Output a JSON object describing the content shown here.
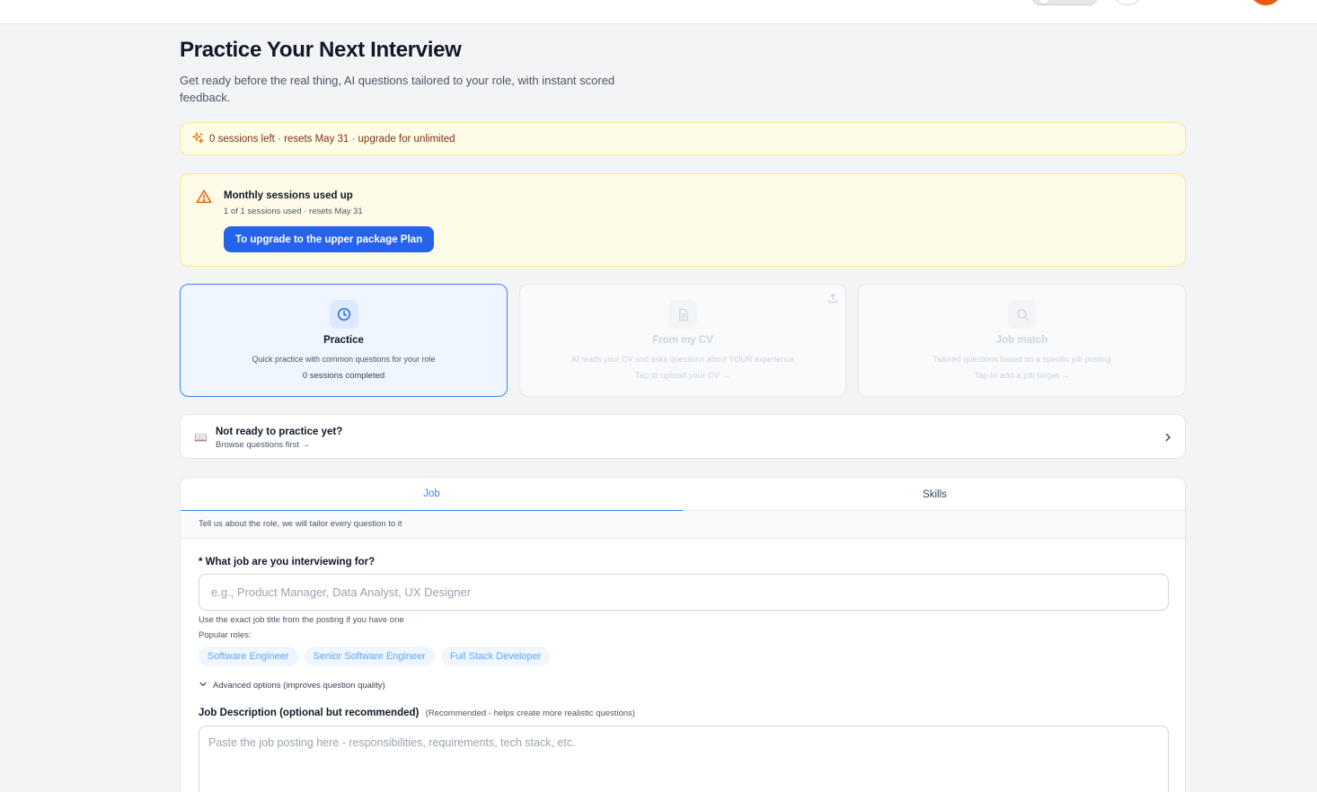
{
  "page": {
    "title": "Practice Your Next Interview",
    "subtitle": "Get ready before the real thing, AI questions tailored to your role, with instant scored feedback."
  },
  "quota": {
    "text": "0 sessions left · resets May 31 · upgrade for unlimited",
    "icon": "sparkles-icon"
  },
  "alert": {
    "title": "Monthly sessions used up",
    "subtitle": "1 of 1 sessions used · resets May 31",
    "button": "To upgrade to the upper package Plan",
    "icon": "warning-icon"
  },
  "modes": [
    {
      "title": "Practice",
      "description": "Quick practice with common questions for your role",
      "footer": "0 sessions completed",
      "icon": "clock-icon",
      "state": "active"
    },
    {
      "title": "From my CV",
      "description": "AI reads your CV and asks questions about YOUR experience",
      "footer": "Tap to upload your CV →",
      "icon": "document-icon",
      "state": "disabled"
    },
    {
      "title": "Job match",
      "description": "Tailored questions based on a specific job posting",
      "footer": "Tap to add a job target →",
      "icon": "search-icon",
      "state": "disabled"
    }
  ],
  "browse": {
    "title": "Not ready to practice yet?",
    "subtitle": "Browse questions first →",
    "icon": "📖"
  },
  "form": {
    "tabs": [
      {
        "label": "Job",
        "active": true
      },
      {
        "label": "Skills",
        "active": false
      }
    ],
    "hint": "Tell us about the role, we will tailor every question to it",
    "job_label": "* What job are you interviewing for?",
    "job_placeholder": "e.g., Product Manager, Data Analyst, UX Designer",
    "job_value": "",
    "helper": "Use the exact job title from the posting if you have one",
    "popular_label": "Popular roles:",
    "popular_roles": [
      "Software Engineer",
      "Senior Software Engineer",
      "Full Stack Developer"
    ],
    "advanced_label": "Advanced options (improves question quality)",
    "jd_label": "Job Description (optional but recommended)",
    "jd_recommended": "(Recommended - helps create more realistic questions)",
    "jd_placeholder": "Paste the job posting here - responsibilities, requirements, tech stack, etc."
  },
  "colors": {
    "accent": "#2563eb",
    "active_border": "#3b82f6",
    "warning_bg": "#fefce8",
    "warning_border": "#fde68a",
    "avatar": "#ea580c"
  }
}
